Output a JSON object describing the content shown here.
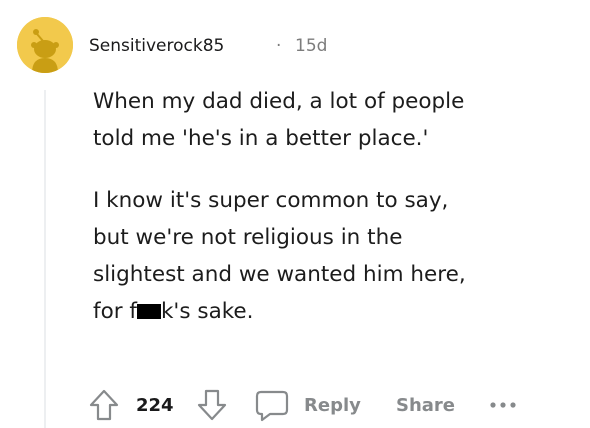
{
  "comment": {
    "author": "Sensitiverock85",
    "separator": "·",
    "age": "15d",
    "paragraphs": [
      {
        "lines": [
          "When my dad died, a lot of people",
          "told me 'he's in a better place.'"
        ]
      },
      {
        "lines": [
          "I know it's super common to say,",
          "but we're not religious in the",
          "slightest and we wanted him here,"
        ],
        "censored_line": {
          "before": "for f",
          "after": "k's sake."
        }
      }
    ]
  },
  "actions": {
    "upvote_icon": "arrow-up-outline-icon",
    "vote_count": "224",
    "downvote_icon": "arrow-down-outline-icon",
    "reply_icon": "speech-bubble-icon",
    "reply_label": "Reply",
    "share_label": "Share",
    "more_icon": "ellipsis-icon"
  },
  "colors": {
    "avatar_bg": "#f2c94c",
    "avatar_fg": "#c99e14",
    "meta_gray": "#7c7c7c",
    "action_gray": "#878a8c",
    "text": "#1c1c1c"
  }
}
